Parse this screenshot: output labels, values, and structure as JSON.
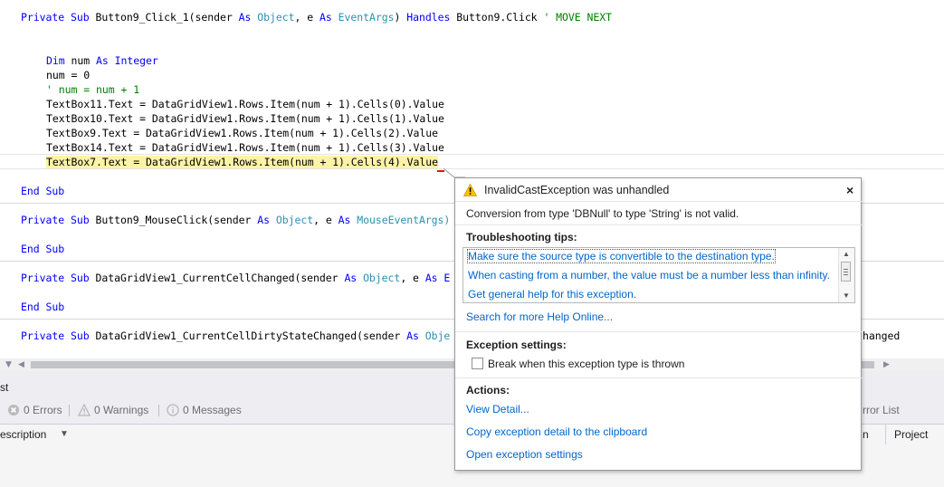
{
  "code": {
    "l1": {
      "kw1": "Private Sub ",
      "name": "Button9_Click_1(sender ",
      "kw2": "As ",
      "ty1": "Object",
      "mid": ", e ",
      "kw3": "As ",
      "ty2": "EventArgs",
      "end": ") ",
      "kw4": "Handles ",
      "handler": "Button9.Click ",
      "comment": "' MOVE NEXT"
    },
    "l2": {
      "kw1": "Dim ",
      "var": "num ",
      "kw2": "As Integer"
    },
    "l3": "num = 0",
    "l4": "' num = num + 1",
    "l5": "TextBox11.Text = DataGridView1.Rows.Item(num + 1).Cells(0).Value",
    "l6": "TextBox10.Text = DataGridView1.Rows.Item(num + 1).Cells(1).Value",
    "l7": "TextBox9.Text = DataGridView1.Rows.Item(num + 1).Cells(2).Value",
    "l8": "TextBox14.Text = DataGridView1.Rows.Item(num + 1).Cells(3).Value",
    "l9": "TextBox7.Text = DataGridView1.Rows.Item(num + 1).Cells(4).Value",
    "endsub": "End Sub",
    "l11": {
      "kw1": "Private Sub ",
      "name": "Button9_MouseClick(sender ",
      "kw2": "As ",
      "ty1": "Object",
      "mid": ", e ",
      "kw3": "As ",
      "ty2": "MouseEventArgs)"
    },
    "l13": {
      "kw1": "Private Sub ",
      "name": "DataGridView1_CurrentCellChanged(sender ",
      "kw2": "As ",
      "ty1": "Object",
      "mid": ", e ",
      "kw3": "As E"
    },
    "l15": {
      "kw1": "Private Sub ",
      "name": "DataGridView1_CurrentCellDirtyStateChanged(sender ",
      "kw2": "As ",
      "ty1": "Obje",
      "tail": "hanged"
    }
  },
  "popup": {
    "title": "InvalidCastException was unhandled",
    "close": "×",
    "message": "Conversion from type 'DBNull' to type 'String' is not valid.",
    "tips_heading": "Troubleshooting tips:",
    "tips": [
      "Make sure the source type is convertible to the destination type.",
      "When casting from a number, the value must be a number less than infinity.",
      "Get general help for this exception."
    ],
    "search_link": "Search for more Help Online...",
    "settings_heading": "Exception settings:",
    "break_label": "Break when this exception type is thrown",
    "actions_heading": "Actions:",
    "actions": [
      "View Detail...",
      "Copy exception detail to the clipboard",
      "Open exception settings"
    ]
  },
  "error_list": {
    "tab_fragment": "st",
    "errors": "0 Errors",
    "warnings": "0 Warnings",
    "messages": "0 Messages",
    "error_list_fragment": "rror List",
    "col_description": "escription",
    "col_line_fragment": "n",
    "col_project": "Project"
  },
  "colors": {
    "keyword": "#0000ff",
    "type": "#2b91af",
    "comment": "#008000",
    "highlight": "#fdf3a6",
    "link": "#0066cc"
  }
}
